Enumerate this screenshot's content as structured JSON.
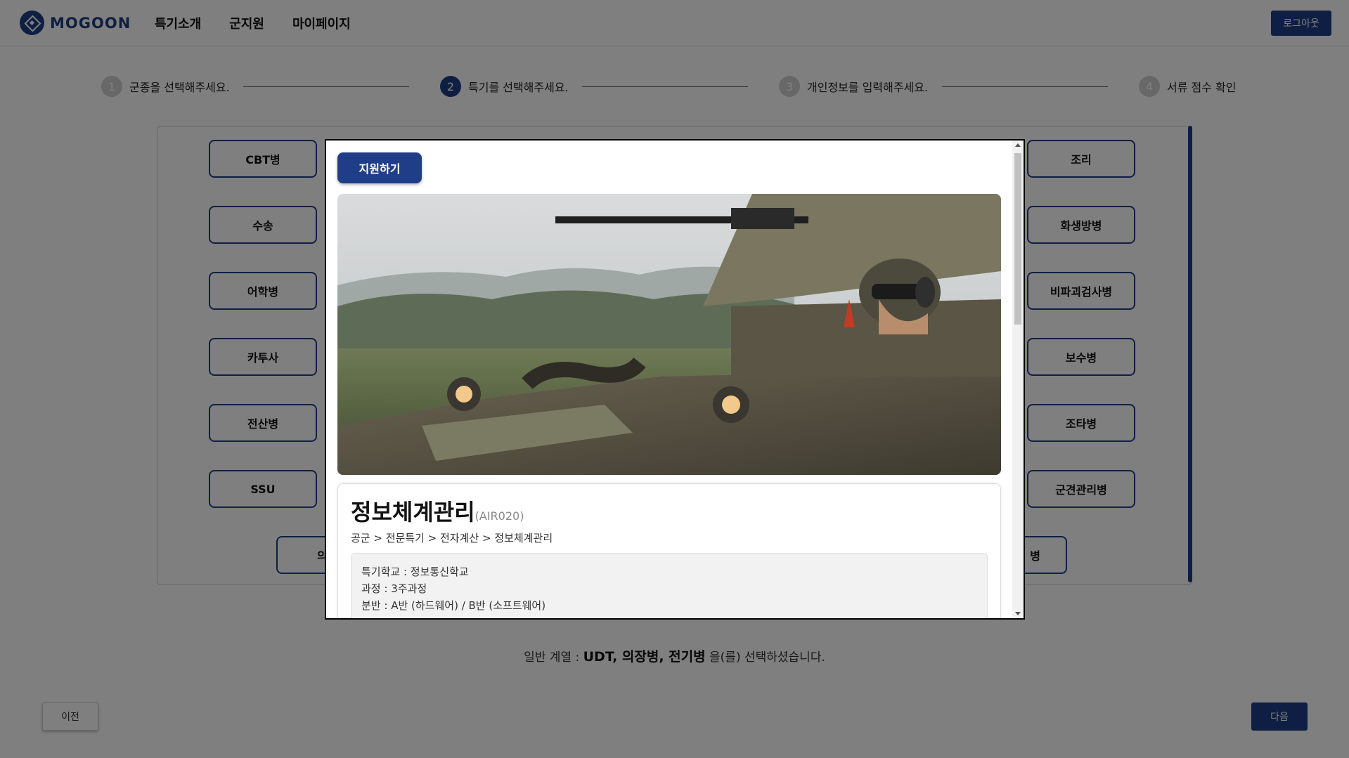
{
  "header": {
    "logo_text": "MOGOON",
    "nav": [
      "특기소개",
      "군지원",
      "마이페이지"
    ],
    "logout_label": "로그아웃"
  },
  "steps": [
    {
      "num": "1",
      "label": "군종을 선택해주세요."
    },
    {
      "num": "2",
      "label": "특기를 선택해주세요."
    },
    {
      "num": "3",
      "label": "개인정보를 입력해주세요."
    },
    {
      "num": "4",
      "label": "서류 점수 확인"
    }
  ],
  "specialties": {
    "left": [
      "CBT병",
      "수송",
      "어학병",
      "카투사",
      "전산병",
      "SSU"
    ],
    "right": [
      "조리",
      "화생방병",
      "비파괴검사병",
      "보수병",
      "조타병",
      "군견관리병"
    ],
    "bottom_left_partial": "의",
    "bottom_right_partial": "병"
  },
  "summary": {
    "prefix": "일반 계열 : ",
    "selected": "UDT, 의장병, 전기병",
    "suffix": " 을(를) 선택하셨습니다."
  },
  "buttons": {
    "prev": "이전",
    "next": "다음"
  },
  "modal": {
    "apply_label": "지원하기",
    "title": "정보체계관리",
    "code": "(AIR020)",
    "breadcrumb": "공군 > 전문특기 > 전자계산 > 정보체계관리",
    "details": [
      "특기학교 : 정보통신학교",
      "과정 : 3주과정",
      "분반 : A반 (하드웨어) / B반 (소프트웨어)"
    ]
  },
  "colors": {
    "accent": "#1f3e87"
  }
}
